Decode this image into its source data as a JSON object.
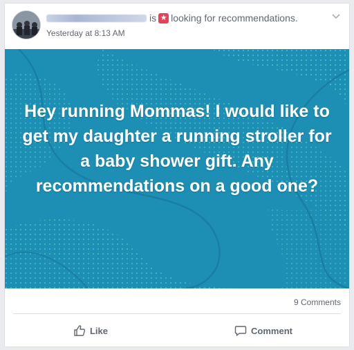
{
  "post": {
    "action_prefix": "is",
    "recommendation_icon": "star-badge-icon",
    "action_text": "looking for recommendations.",
    "timestamp": "Yesterday at 8:13 AM",
    "body_text": "Hey running Mommas! I would like to get my daughter a running stroller for a baby shower gift. Any recommendations on a good one?",
    "comments_count": "9 Comments"
  },
  "actions": {
    "like_label": "Like",
    "comment_label": "Comment"
  },
  "colors": {
    "banner_bg": "#1d8fb5",
    "dots": "#4fd0c4",
    "badge": "#e8425a"
  }
}
